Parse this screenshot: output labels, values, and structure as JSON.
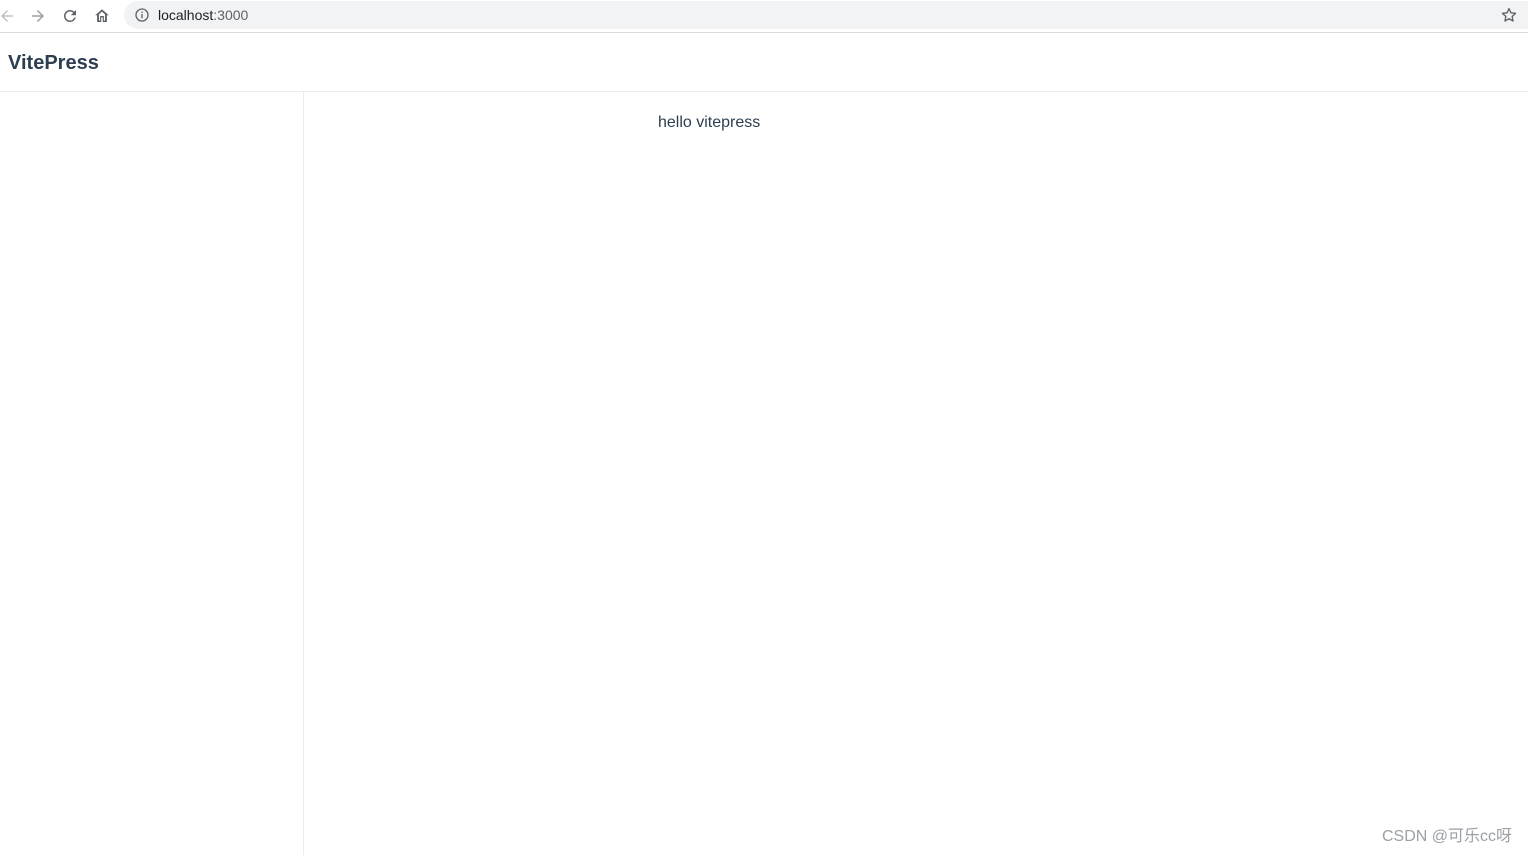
{
  "browser": {
    "url_host": "localhost",
    "url_port": ":3000"
  },
  "site": {
    "title": "VitePress"
  },
  "content": {
    "text": "hello vitepress"
  },
  "watermark": {
    "text": "CSDN @可乐cc呀"
  },
  "icons": {
    "back": "arrow-left-icon",
    "forward": "arrow-right-icon",
    "reload": "reload-icon",
    "home": "home-icon",
    "info": "info-icon",
    "bookmark": "star-icon"
  },
  "colors": {
    "text": "#2c3e50",
    "border": "#eaecef",
    "address_bar": "#f1f3f4"
  }
}
